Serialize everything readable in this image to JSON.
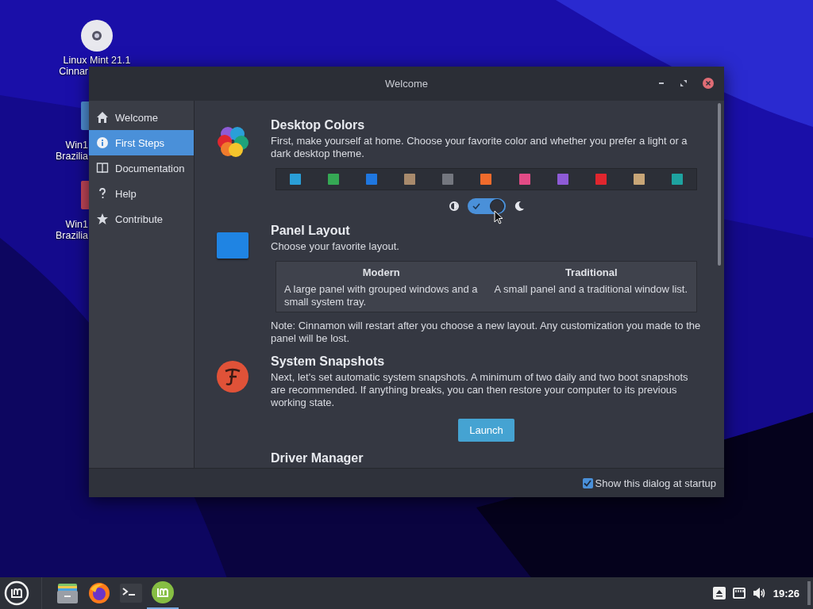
{
  "desktop": {
    "icons": [
      {
        "kind": "disc",
        "lines": [
          "Linux Mint 21.1",
          "Cinnar"
        ]
      },
      {
        "kind": "blue",
        "lines": [
          "Win1",
          "Brazilia"
        ]
      },
      {
        "kind": "red",
        "lines": [
          "Win1",
          "Brazilia"
        ]
      }
    ]
  },
  "window": {
    "title": "Welcome"
  },
  "sidebar": {
    "items": [
      {
        "kind": "home",
        "label": "Welcome",
        "selected": false
      },
      {
        "kind": "info",
        "label": "First Steps",
        "selected": true
      },
      {
        "kind": "book",
        "label": "Documentation",
        "selected": false
      },
      {
        "kind": "help",
        "label": "Help",
        "selected": false
      },
      {
        "kind": "star",
        "label": "Contribute",
        "selected": false
      }
    ]
  },
  "sections": [
    {
      "kind": "colors",
      "title": "Desktop Colors",
      "text": "First, make yourself at home. Choose your favorite color and whether you prefer a light or a dark desktop theme.",
      "swatches": [
        {
          "color": "#2a9fd8"
        },
        {
          "color": "#35a854"
        },
        {
          "color": "#1f77e0"
        },
        {
          "color": "#a88a6c"
        },
        {
          "color": "#74777f"
        },
        {
          "color": "#f06b2c"
        },
        {
          "color": "#e24b86"
        },
        {
          "color": "#8e5bd6"
        },
        {
          "color": "#e0262e"
        },
        {
          "color": "#c8a677"
        },
        {
          "color": "#1ea3a0"
        }
      ],
      "dark_theme": true
    },
    {
      "kind": "layout",
      "title": "Panel Layout",
      "text": "Choose your favorite layout.",
      "options": [
        {
          "title": "Modern",
          "text": "A large panel with grouped windows and a small system tray."
        },
        {
          "title": "Traditional",
          "text": "A small panel and a traditional window list."
        }
      ],
      "note": "Note: Cinnamon will restart after you choose a new layout. Any customization you made to the panel will be lost."
    },
    {
      "kind": "snapshots",
      "title": "System Snapshots",
      "text": "Next, let's set automatic system snapshots. A minimum of two daily and two boot snapshots are recommended. If anything breaks, you can then restore your computer to its previous working state.",
      "button": "Launch"
    },
    {
      "kind": "drivers",
      "title": "Driver Manager"
    }
  ],
  "footer": {
    "checkbox": {
      "label": "Show this dialog at startup",
      "checked": true
    }
  },
  "taskbar": {
    "apps": [
      {
        "kind": "files",
        "active": false
      },
      {
        "kind": "firefox",
        "active": false
      },
      {
        "kind": "terminal",
        "active": false
      },
      {
        "kind": "mint",
        "active": true
      }
    ],
    "time": "19:26"
  }
}
